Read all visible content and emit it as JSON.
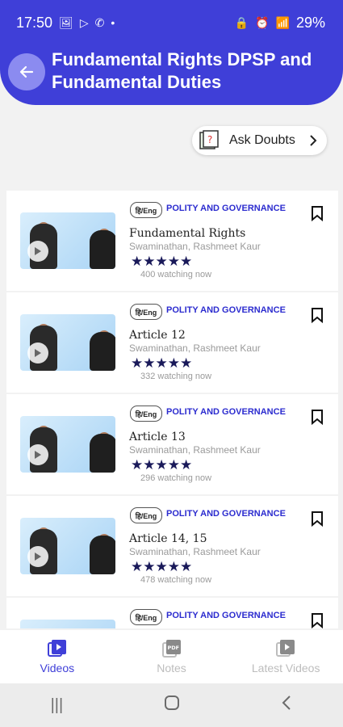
{
  "status_bar": {
    "time": "17:50",
    "battery": "29%",
    "dot": "•"
  },
  "header": {
    "title": "Fundamental Rights DPSP and Fundamental Duties",
    "back_icon": "arrow-left-icon",
    "color": "#3f3fd8"
  },
  "ask_doubts": {
    "label": "Ask Doubts"
  },
  "videos": [
    {
      "lang": "हि/Eng",
      "category": "POLITY AND GOVERNANCE",
      "title": "Fundamental Rights",
      "author": "Swaminathan, Rashmeet Kaur",
      "stars": "★★★★★",
      "watching": "400 watching now"
    },
    {
      "lang": "हि/Eng",
      "category": "POLITY AND GOVERNANCE",
      "title": "Article 12",
      "author": "Swaminathan, Rashmeet Kaur",
      "stars": "★★★★★",
      "watching": "332 watching now"
    },
    {
      "lang": "हि/Eng",
      "category": "POLITY AND GOVERNANCE",
      "title": "Article 13",
      "author": "Swaminathan, Rashmeet Kaur",
      "stars": "★★★★★",
      "watching": "296 watching now"
    },
    {
      "lang": "हि/Eng",
      "category": "POLITY AND GOVERNANCE",
      "title": "Article 14, 15",
      "author": "Swaminathan, Rashmeet Kaur",
      "stars": "★★★★★",
      "watching": "478 watching now"
    },
    {
      "lang": "हि/Eng",
      "category": "POLITY AND GOVERNANCE",
      "title": "",
      "author": "",
      "stars": "",
      "watching": ""
    }
  ],
  "bottom_nav": {
    "videos": "Videos",
    "notes": "Notes",
    "latest": "Latest Videos"
  },
  "colors": {
    "primary": "#3f3fd8",
    "star": "#1a1a5a"
  }
}
